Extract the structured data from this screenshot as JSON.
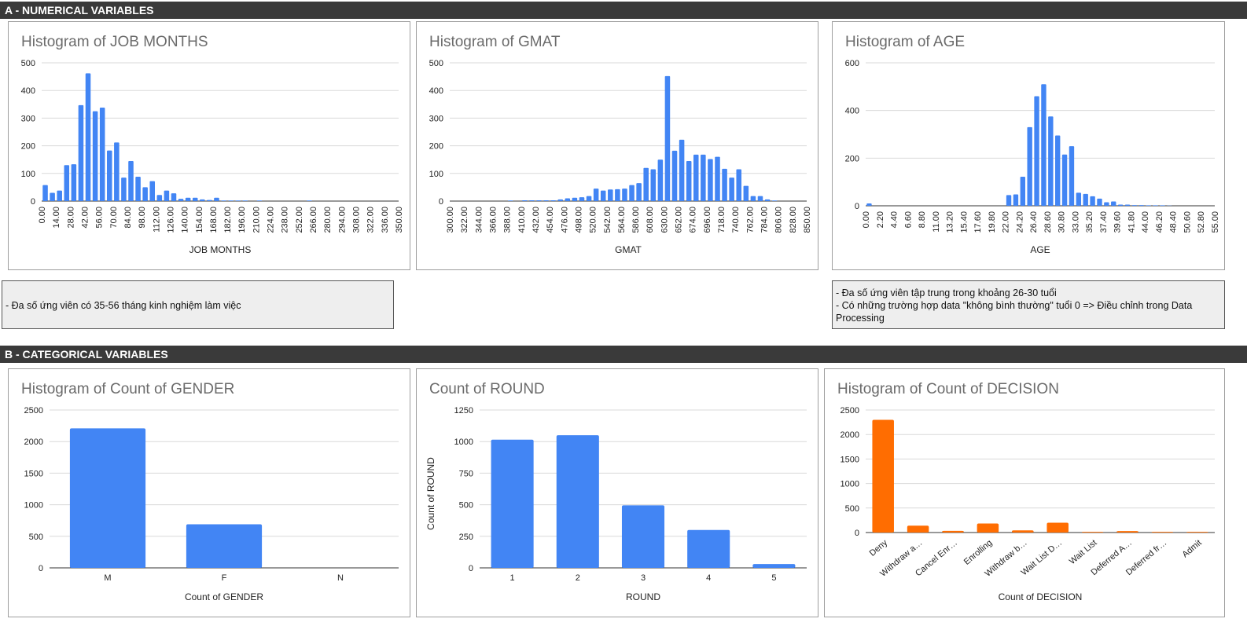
{
  "sections": {
    "a_title": "A - NUMERICAL VARIABLES",
    "b_title": "B - CATEGORICAL VARIABLES"
  },
  "notes": {
    "job_months": [
      "- Đa số ứng viên có 35-56 tháng kinh nghiệm làm việc"
    ],
    "age": [
      "- Đa số ứng viên tập trung trong khoảng 26-30 tuổi",
      "- Có những trường hợp data \"không bình thường\" tuổi 0 => Điều chỉnh trong Data",
      "Processing"
    ]
  },
  "chart_data": [
    {
      "id": "job",
      "type": "bar",
      "title": "Histogram of JOB MONTHS",
      "xlabel": "JOB MONTHS",
      "ylabel": "",
      "ylim": [
        0,
        500
      ],
      "yticks": [
        "0",
        "100",
        "200",
        "300",
        "400",
        "500"
      ],
      "xlim": [
        0,
        350
      ],
      "xticks": [
        "0.00",
        "14.00",
        "28.00",
        "42.00",
        "56.00",
        "70.00",
        "84.00",
        "98.00",
        "112.00",
        "126.00",
        "140.00",
        "154.00",
        "168.00",
        "182.00",
        "196.00",
        "210.00",
        "224.00",
        "238.00",
        "252.00",
        "266.00",
        "280.00",
        "294.00",
        "308.00",
        "322.00",
        "336.00",
        "350.00"
      ],
      "bin_width": 7,
      "values": [
        58,
        30,
        38,
        130,
        133,
        347,
        462,
        325,
        338,
        183,
        212,
        85,
        145,
        88,
        50,
        72,
        22,
        38,
        28,
        8,
        12,
        12,
        6,
        4,
        12,
        2,
        2,
        2,
        2,
        0,
        2,
        0,
        0,
        0,
        0,
        0,
        0,
        2,
        0,
        0,
        0,
        0,
        0,
        0,
        0,
        0,
        0,
        0,
        0,
        0
      ],
      "color": "#4285f4",
      "grid": true
    },
    {
      "id": "gmat",
      "type": "bar",
      "title": "Histogram of GMAT",
      "xlabel": "GMAT",
      "ylabel": "",
      "ylim": [
        0,
        500
      ],
      "yticks": [
        "0",
        "100",
        "200",
        "300",
        "400",
        "500"
      ],
      "xlim": [
        300,
        850
      ],
      "xticks": [
        "300.00",
        "322.00",
        "344.00",
        "366.00",
        "388.00",
        "410.00",
        "432.00",
        "454.00",
        "476.00",
        "498.00",
        "520.00",
        "542.00",
        "564.00",
        "586.00",
        "608.00",
        "630.00",
        "652.00",
        "674.00",
        "696.00",
        "718.00",
        "740.00",
        "762.00",
        "784.00",
        "806.00",
        "828.00",
        "850.00"
      ],
      "bin_width": 11,
      "values": [
        0,
        0,
        0,
        0,
        0,
        0,
        0,
        0,
        2,
        0,
        3,
        3,
        3,
        3,
        3,
        6,
        10,
        12,
        14,
        18,
        45,
        38,
        42,
        43,
        45,
        58,
        65,
        120,
        115,
        150,
        452,
        182,
        222,
        145,
        168,
        168,
        152,
        160,
        117,
        85,
        115,
        55,
        18,
        18,
        6,
        2,
        0,
        0,
        0,
        0
      ],
      "color": "#4285f4",
      "grid": true
    },
    {
      "id": "age",
      "type": "bar",
      "title": "Histogram of AGE",
      "xlabel": "AGE",
      "ylabel": "",
      "ylim": [
        0,
        600
      ],
      "yticks": [
        "0",
        "200",
        "400",
        "600"
      ],
      "xlim": [
        0,
        55
      ],
      "xticks": [
        "0.00",
        "2.20",
        "4.40",
        "6.60",
        "8.80",
        "11.00",
        "13.20",
        "15.40",
        "17.60",
        "19.80",
        "22.00",
        "24.20",
        "26.40",
        "28.60",
        "30.80",
        "33.00",
        "35.20",
        "37.40",
        "39.60",
        "41.80",
        "44.00",
        "46.20",
        "48.40",
        "50.60",
        "52.80",
        "55.00"
      ],
      "bin_width": 1.1,
      "values": [
        10,
        0,
        0,
        0,
        0,
        0,
        0,
        0,
        0,
        0,
        0,
        0,
        0,
        0,
        0,
        0,
        0,
        0,
        0,
        0,
        45,
        48,
        122,
        330,
        460,
        510,
        375,
        295,
        215,
        250,
        55,
        50,
        40,
        30,
        15,
        18,
        5,
        5,
        3,
        3,
        2,
        2,
        2,
        1,
        0,
        0,
        0,
        0,
        0,
        0
      ],
      "color": "#4285f4",
      "grid": true
    },
    {
      "id": "gender",
      "type": "bar",
      "title": "Histogram of Count of GENDER",
      "xlabel": "Count of GENDER",
      "ylabel": "",
      "ylim": [
        0,
        2500
      ],
      "yticks": [
        "0",
        "500",
        "1000",
        "1500",
        "2000",
        "2500"
      ],
      "categories": [
        "M",
        "F",
        "N"
      ],
      "values": [
        2210,
        690,
        0
      ],
      "color": "#4285f4",
      "grid": true
    },
    {
      "id": "round",
      "type": "bar",
      "title": "Count of ROUND",
      "xlabel": "ROUND",
      "ylabel": "Count of ROUND",
      "ylim": [
        0,
        1250
      ],
      "yticks": [
        "0",
        "250",
        "500",
        "750",
        "1000",
        "1250"
      ],
      "categories": [
        "1",
        "2",
        "3",
        "4",
        "5"
      ],
      "values": [
        1015,
        1050,
        495,
        300,
        30
      ],
      "color": "#4285f4",
      "grid": true
    },
    {
      "id": "decision",
      "type": "bar",
      "title": "Histogram of Count of DECISION",
      "xlabel": "Count of DECISION",
      "ylabel": "",
      "ylim": [
        0,
        2500
      ],
      "yticks": [
        "0",
        "500",
        "1000",
        "1500",
        "2000",
        "2500"
      ],
      "categories": [
        "Deny",
        "Withdraw a…",
        "Cancel Enr…",
        "Enrolling",
        "Withdraw b…",
        "Wait List D…",
        "Wait List",
        "Deferred A…",
        "Deferred fr…",
        "Admit"
      ],
      "values": [
        2300,
        140,
        35,
        185,
        45,
        200,
        15,
        30,
        15,
        15
      ],
      "color": "#ff6d01",
      "grid": true
    }
  ]
}
